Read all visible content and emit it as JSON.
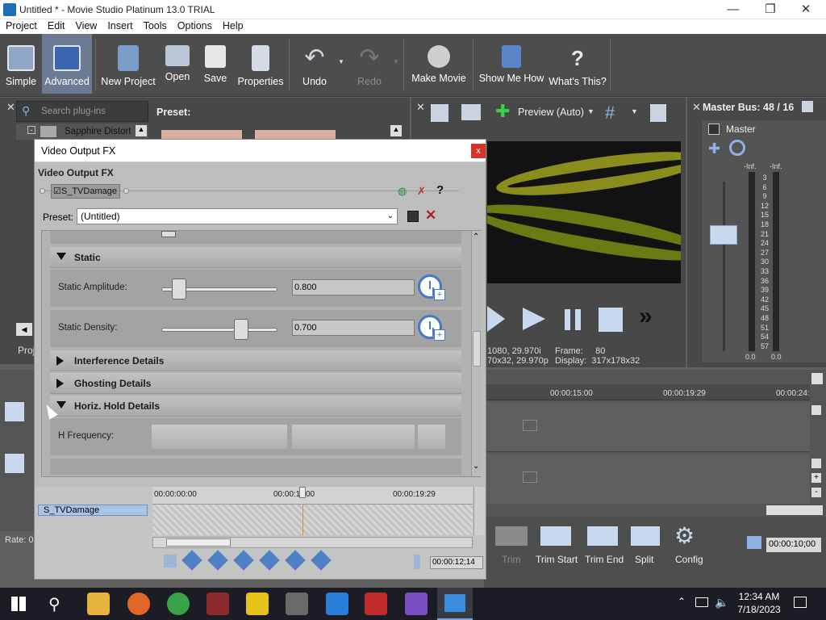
{
  "window": {
    "title": "Untitled * - Movie Studio Platinum 13.0 TRIAL"
  },
  "menu": [
    "Project",
    "Edit",
    "View",
    "Insert",
    "Tools",
    "Options",
    "Help"
  ],
  "toolbar": {
    "simple": "Simple",
    "advanced": "Advanced",
    "new_project": "New Project",
    "open": "Open",
    "save": "Save",
    "properties": "Properties",
    "undo": "Undo",
    "redo": "Redo",
    "make_movie": "Make Movie",
    "show_me_how": "Show Me How",
    "whats_this": "What's This?"
  },
  "plugins": {
    "search_placeholder": "Search plug-ins",
    "item": "Sapphire Distort",
    "preset_label": "Preset:",
    "tab": "Proj"
  },
  "rate": "Rate: 0",
  "preview": {
    "mode": "Preview (Auto)",
    "info_left_1": "1080, 29.970i",
    "info_left_2": "70x32, 29.970p",
    "frame_label": "Frame:",
    "frame_value": "80",
    "display_label": "Display:",
    "display_value": "317x178x32"
  },
  "master": {
    "title": "Master Bus: 48 / 16",
    "label": "Master",
    "inf_left": "-Inf.",
    "inf_right": "-Inf.",
    "scale": [
      "3",
      "6",
      "9",
      "12",
      "15",
      "18",
      "21",
      "24",
      "27",
      "30",
      "33",
      "36",
      "39",
      "42",
      "45",
      "48",
      "51",
      "54",
      "57"
    ],
    "bottom_left": "0.0",
    "bottom_right": "0.0"
  },
  "timeline": {
    "t1": "00:00:15:00",
    "t2": "00:00:19:29",
    "t3": "00:00:24:"
  },
  "edit_tools": {
    "trim": "Trim",
    "trim_start": "Trim Start",
    "trim_end": "Trim End",
    "split": "Split",
    "config": "Config",
    "time": "00:00:10;00"
  },
  "dialog": {
    "title": "Video Output FX",
    "close": "x",
    "chain_title": "Video Output FX",
    "fx_name": "S_TVDamage",
    "help": "?",
    "preset_label": "Preset:",
    "preset_value": "(Untitled)",
    "sections": {
      "static": "Static",
      "interference": "Interference Details",
      "ghosting": "Ghosting Details",
      "horiz_hold": "Horiz. Hold Details"
    },
    "params": {
      "static_amplitude_label": "Static Amplitude:",
      "static_amplitude_value": "0.800",
      "static_amplitude": 0.16,
      "static_density_label": "Static Density:",
      "static_density_value": "0.700",
      "static_density": 0.7,
      "h_frequency_label": "H Frequency:"
    },
    "timeline": {
      "t0": "00:00:00:00",
      "t1": "00:00:1",
      "t1b": "00",
      "t2": "00:00:19:29",
      "track": "S_TVDamage",
      "cursor_time": "00:00:12;14"
    }
  },
  "taskbar": {
    "time": "12:34 AM",
    "date": "7/18/2023"
  }
}
